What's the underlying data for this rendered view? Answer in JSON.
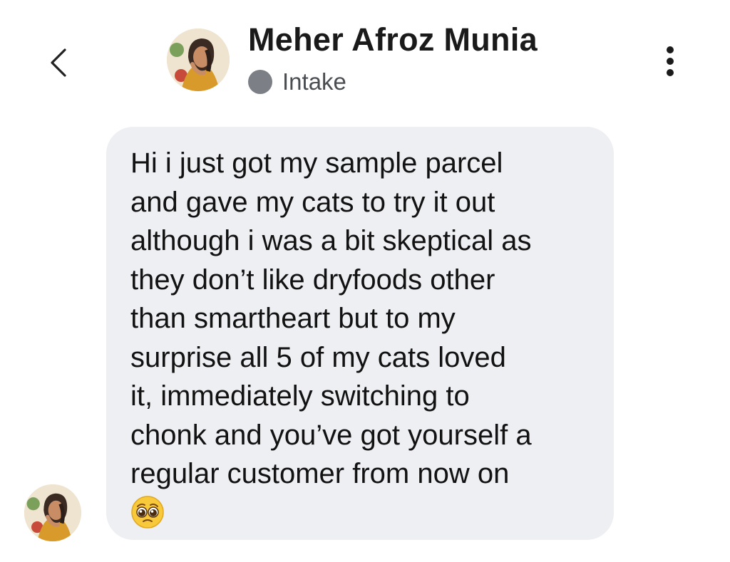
{
  "header": {
    "contact_name": "Meher Afroz Munia",
    "status_label": "Intake",
    "status_color": "#7c7f86"
  },
  "icons": {
    "back": "chevron-left-icon",
    "more": "vertical-ellipsis-icon",
    "emoji": "pleading-face-emoji"
  },
  "message": {
    "text": "Hi i just got my sample parcel\nand gave my cats to try it out\nalthough i was a bit skeptical as\nthey don’t like dryfoods other\nthan smartheart but to my\nsurprise all 5 of my cats loved\nit, immediately switching to\nchonk and you’ve got yourself a\nregular customer from now on",
    "bubble_color": "#eeeff3"
  }
}
